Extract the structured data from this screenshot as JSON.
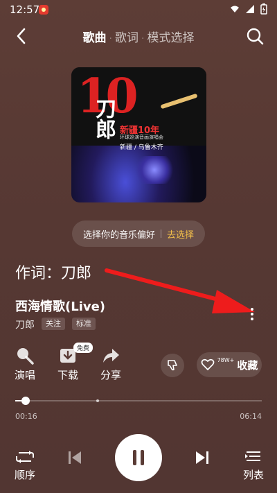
{
  "status_bar": {
    "time": "12:57"
  },
  "nav": {
    "tabs": [
      {
        "label": "歌曲",
        "active": true
      },
      {
        "label": "歌词",
        "active": false
      },
      {
        "label": "模式选择",
        "active": false
      }
    ]
  },
  "album_art": {
    "number": "10",
    "artist_text": "刀郎",
    "title_line": "新疆10年",
    "subtitle_line": "环球巡演音画演唱会",
    "location_line": "新疆 / 乌鲁木齐"
  },
  "preference": {
    "text": "选择你的音乐偏好",
    "action": "去选择",
    "accent": "#f3c04a"
  },
  "lyricist": "作词：刀郎",
  "song": {
    "title": "西海情歌(Live)",
    "artist": "刀郎",
    "follow_label": "关注",
    "quality_label": "标准"
  },
  "actions": {
    "sing": "演唱",
    "download": "下载",
    "download_badge": "免费",
    "share": "分享",
    "collect_label": "收藏",
    "collect_count": "78W+"
  },
  "progress": {
    "current": "00:16",
    "total": "06:14",
    "fraction": 0.043
  },
  "controls": {
    "mode_label": "顺序",
    "playlist_label": "列表"
  },
  "icons": [
    "back-arrow-icon",
    "search-icon",
    "more-vertical-icon",
    "mic-icon",
    "download-icon",
    "share-icon",
    "thumbs-down-icon",
    "heart-icon",
    "repeat-icon",
    "previous-icon",
    "pause-icon",
    "next-icon",
    "playlist-icon"
  ]
}
